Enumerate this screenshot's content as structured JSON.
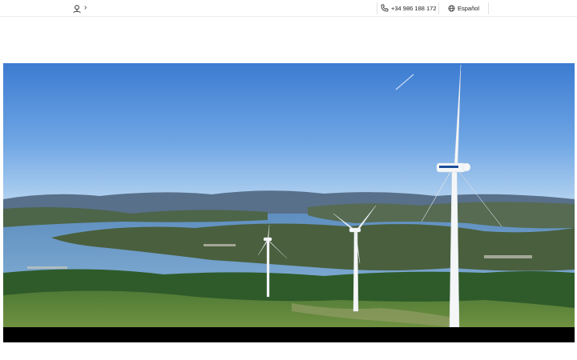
{
  "breadcrumb": {
    "home_icon": "home-pin-icon",
    "separator": "›"
  },
  "contact": {
    "phone": "+34 986 188 172",
    "phone_icon": "phone-icon"
  },
  "language": {
    "selected": "Español",
    "icon": "globe-icon"
  },
  "hero": {
    "image": "wind-turbines-over-estuary",
    "colors": {
      "sky_top": "#3f7fd4",
      "sky_bottom": "#a9cdf0",
      "letterbox": "#000000"
    }
  }
}
